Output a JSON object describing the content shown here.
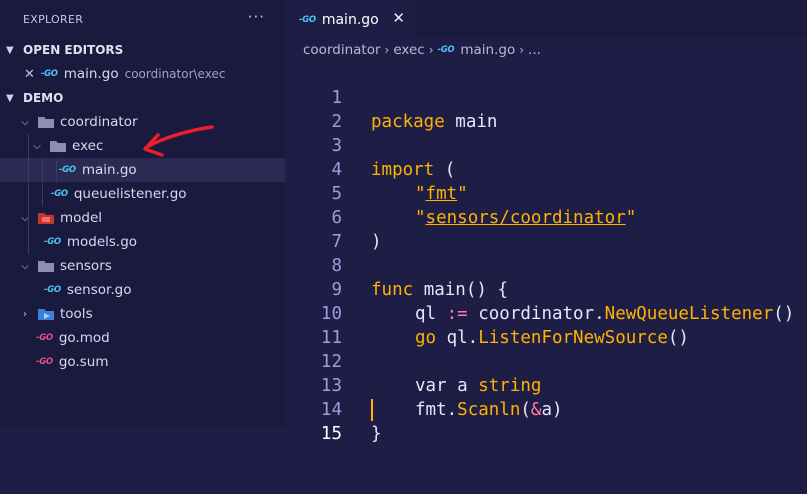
{
  "sidebar": {
    "header": "EXPLORER",
    "more_label": "···",
    "open_editors_label": "OPEN EDITORS",
    "open_editor": {
      "close": "✕",
      "icon": "-GO",
      "name": "main.go",
      "path": "coordinator\\exec"
    },
    "project_label": "DEMO",
    "tree": [
      {
        "label": "coordinator",
        "icon": "folder-icon",
        "expanded": true
      },
      {
        "label": "exec",
        "icon": "folder-icon",
        "expanded": true
      },
      {
        "label": "main.go",
        "icon": "-GO",
        "selected": true
      },
      {
        "label": "queuelistener.go",
        "icon": "-GO"
      },
      {
        "label": "model",
        "icon": "folder-model-icon",
        "expanded": true
      },
      {
        "label": "models.go",
        "icon": "-GO"
      },
      {
        "label": "sensors",
        "icon": "folder-icon",
        "expanded": true
      },
      {
        "label": "sensor.go",
        "icon": "-GO"
      },
      {
        "label": "tools",
        "icon": "folder-tools-icon",
        "expanded": false
      },
      {
        "label": "go.mod",
        "icon": "-GO"
      },
      {
        "label": "go.sum",
        "icon": "-GO"
      }
    ]
  },
  "tab": {
    "icon": "-GO",
    "label": "main.go",
    "close": "✕"
  },
  "breadcrumb": {
    "items": [
      "coordinator",
      "exec",
      "main.go",
      "..."
    ],
    "icon": "-GO"
  },
  "editor": {
    "line_numbers": [
      "1",
      "2",
      "3",
      "4",
      "5",
      "6",
      "7",
      "8",
      "9",
      "10",
      "11",
      "12",
      "13",
      "14",
      "15"
    ],
    "tokens": {
      "l1_kw": "package",
      "l1_id": " main",
      "l3_kw": "import",
      "l3_id": " (",
      "l4_q1": "\"",
      "l4_s": "fmt",
      "l4_q2": "\"",
      "l5_q1": "\"",
      "l5_s": "sensors/coordinator",
      "l5_q2": "\"",
      "l6_id": ")",
      "l8_kw": "func",
      "l8_id": " main() {",
      "l9_a": "ql ",
      "l9_op": ":=",
      "l9_b": " coordinator.",
      "l9_fn": "NewQueueListener",
      "l9_c": "()",
      "l10_kw": "go",
      "l10_a": " ql.",
      "l10_fn": "ListenForNewSource",
      "l10_b": "()",
      "l12_kw": "var",
      "l12_a": " a ",
      "l12_t": "string",
      "l13_a": "fmt.",
      "l13_fn": "Scanln",
      "l13_b": "(",
      "l13_op": "&",
      "l13_c": "a)",
      "l14_id": "}"
    }
  },
  "colors": {
    "accent": "#ffb300",
    "annotation_arrow": "#e8202a",
    "go_icon": "#4fc3f7"
  }
}
